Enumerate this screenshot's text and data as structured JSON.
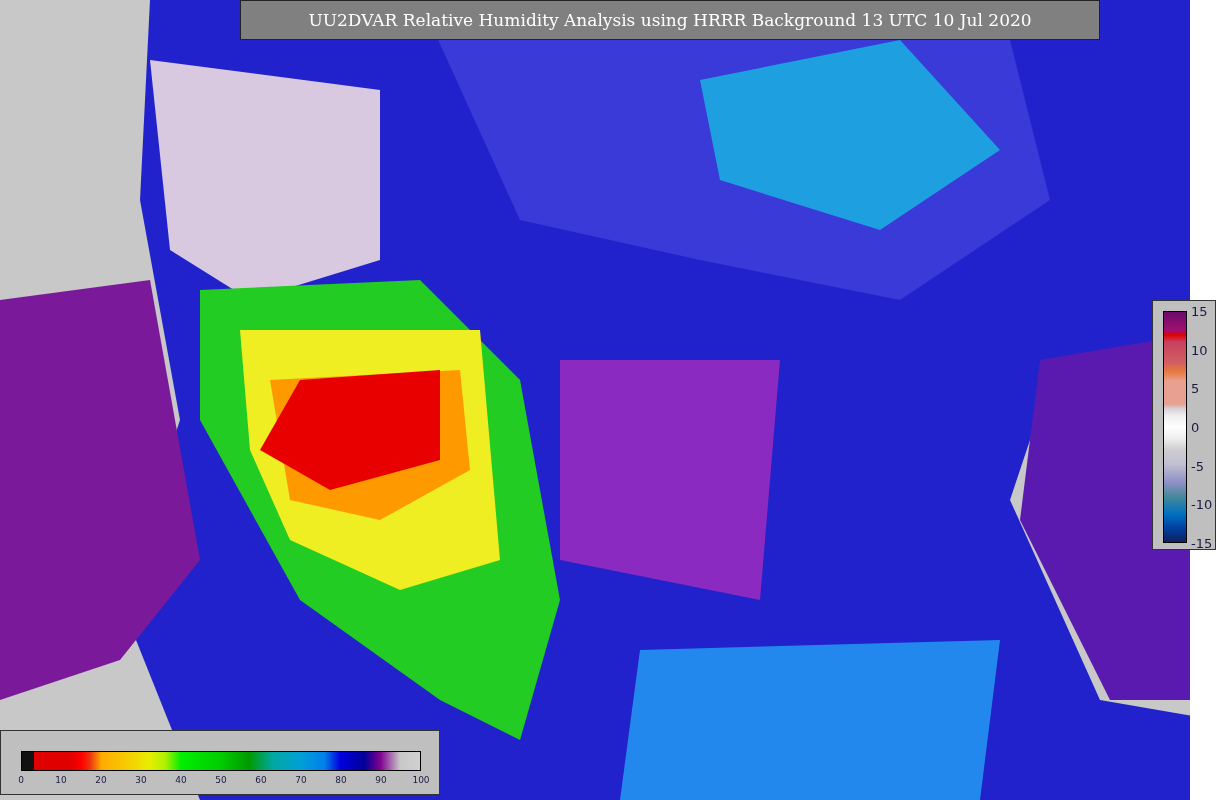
{
  "title": "UU2DVAR Relative Humidity Analysis using HRRR Background 13 UTC 10 Jul 2020",
  "humidity_colorbar": {
    "ticks": [
      "0",
      "10",
      "20",
      "30",
      "40",
      "50",
      "60",
      "70",
      "80",
      "90",
      "100"
    ]
  },
  "increment_colorbar": {
    "ticks": [
      "15",
      "10",
      "5",
      "0",
      "-5",
      "-10",
      "-15"
    ]
  }
}
